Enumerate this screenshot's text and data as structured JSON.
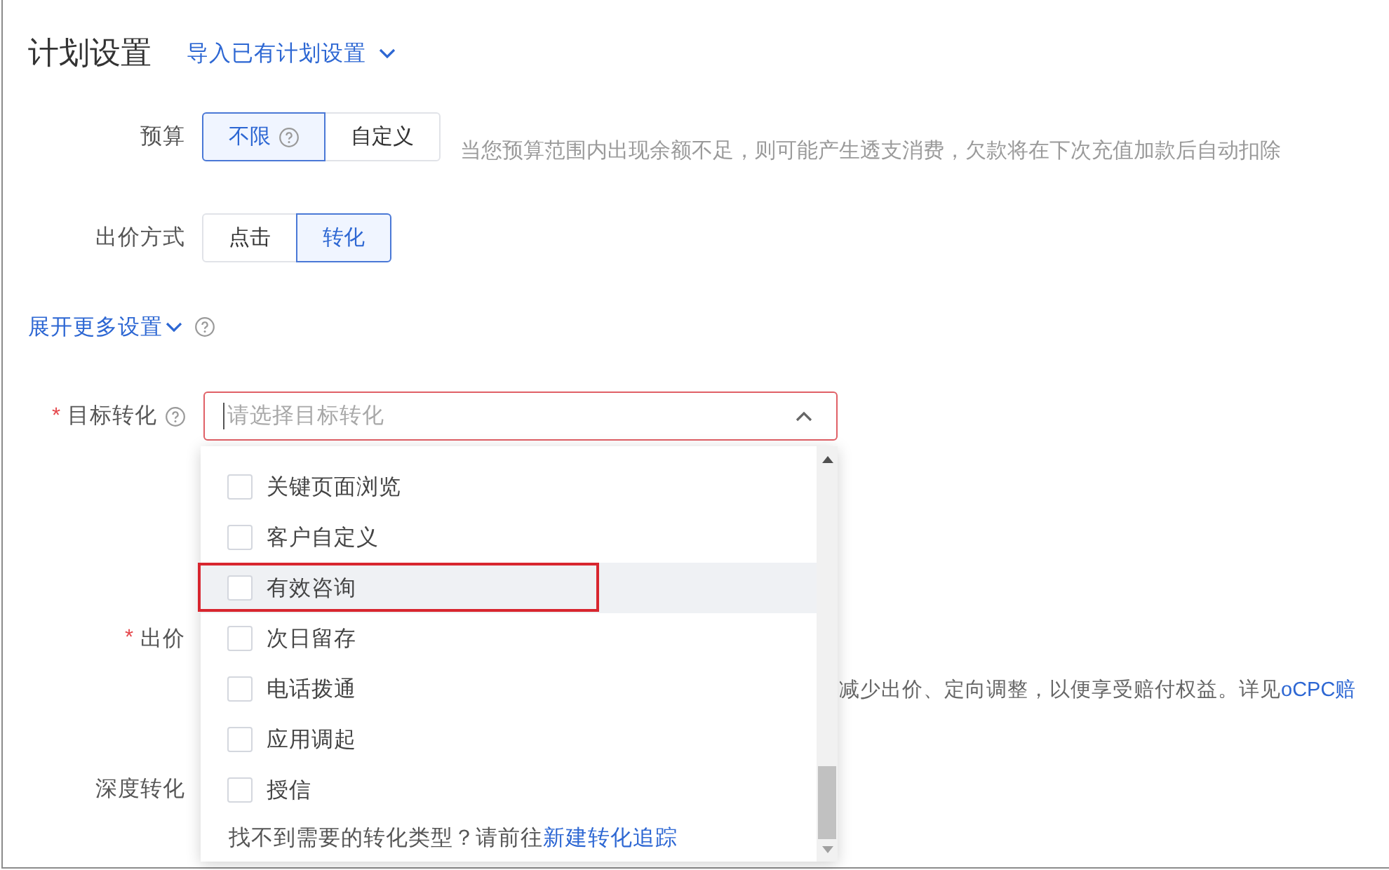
{
  "header": {
    "title": "计划设置",
    "import_link": {
      "label": "导入已有计划设置",
      "expanded": false
    }
  },
  "budget": {
    "label": "预算",
    "options": [
      {
        "label": "不限",
        "help": true,
        "selected": true
      },
      {
        "label": "自定义",
        "help": false,
        "selected": false
      }
    ],
    "hint": "当您预算范围内出现余额不足，则可能产生透支消费，欠款将在下次充值加款后自动扣除"
  },
  "bid_mode": {
    "label": "出价方式",
    "options": [
      {
        "label": "点击",
        "help": false,
        "selected": false
      },
      {
        "label": "转化",
        "help": false,
        "selected": true
      }
    ]
  },
  "more_settings": {
    "label": "展开更多设置",
    "expanded": false,
    "help": true
  },
  "target_conversion": {
    "required_mark": "*",
    "label": "目标转化",
    "help": true,
    "placeholder": "请选择目标转化",
    "focused": true,
    "error": true,
    "open": true,
    "options": [
      {
        "label": "关键页面浏览",
        "checked": false,
        "hovered": false,
        "annotated": false
      },
      {
        "label": "客户自定义",
        "checked": false,
        "hovered": false,
        "annotated": false
      },
      {
        "label": "有效咨询",
        "checked": false,
        "hovered": true,
        "annotated": true
      },
      {
        "label": "次日留存",
        "checked": false,
        "hovered": false,
        "annotated": false
      },
      {
        "label": "电话拨通",
        "checked": false,
        "hovered": false,
        "annotated": false
      },
      {
        "label": "应用调起",
        "checked": false,
        "hovered": false,
        "annotated": false
      },
      {
        "label": "授信",
        "checked": false,
        "hovered": false,
        "annotated": false
      }
    ],
    "footer_text": "找不到需要的转化类型？请前往",
    "footer_link": "新建转化追踪"
  },
  "bid": {
    "required_mark": "*",
    "label": "出价",
    "note": "减少出价、定向调整，以便享受赔付权益。详见",
    "note_link": "oCPC赔"
  },
  "deep_conversion": {
    "label": "深度转化"
  }
}
